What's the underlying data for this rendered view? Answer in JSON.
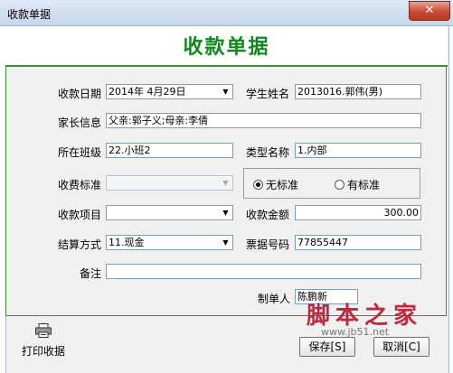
{
  "window": {
    "title": "收款单据",
    "close_glyph": "✕"
  },
  "header": {
    "title": "收款单据"
  },
  "form": {
    "date_label": "收款日期",
    "date_value": "2014年 4月29日",
    "student_label": "学生姓名",
    "student_value": "2013016.郭伟(男)",
    "parent_label": "家长信息",
    "parent_value": "父亲:郭子义;母亲:李倩",
    "class_label": "所在班级",
    "class_value": "22.小班2",
    "type_label": "类型名称",
    "type_value": "1.内部",
    "standard_label": "收费标准",
    "standard_value": "",
    "radio_no_standard": "无标准",
    "radio_has_standard": "有标准",
    "radio_selected": "no_standard",
    "item_label": "收款项目",
    "item_value": "",
    "amount_label": "收款金额",
    "amount_value": "300.00",
    "settle_label": "结算方式",
    "settle_value": "11.现金",
    "ticket_label": "票据号码",
    "ticket_value": "77855447",
    "remark_label": "备注",
    "remark_value": "",
    "maker_label": "制单人",
    "maker_value": "陈鹏新"
  },
  "footer": {
    "print_label": "打印收据",
    "save_label": "保存[S]",
    "cancel_label": "取消[C]"
  },
  "watermark": {
    "text": "脚本之家",
    "url": "www.jb51.net"
  },
  "colors": {
    "title_green": "#0c8a1c",
    "panel_border": "#3b8b3b",
    "watermark_red": "#c0283c"
  }
}
